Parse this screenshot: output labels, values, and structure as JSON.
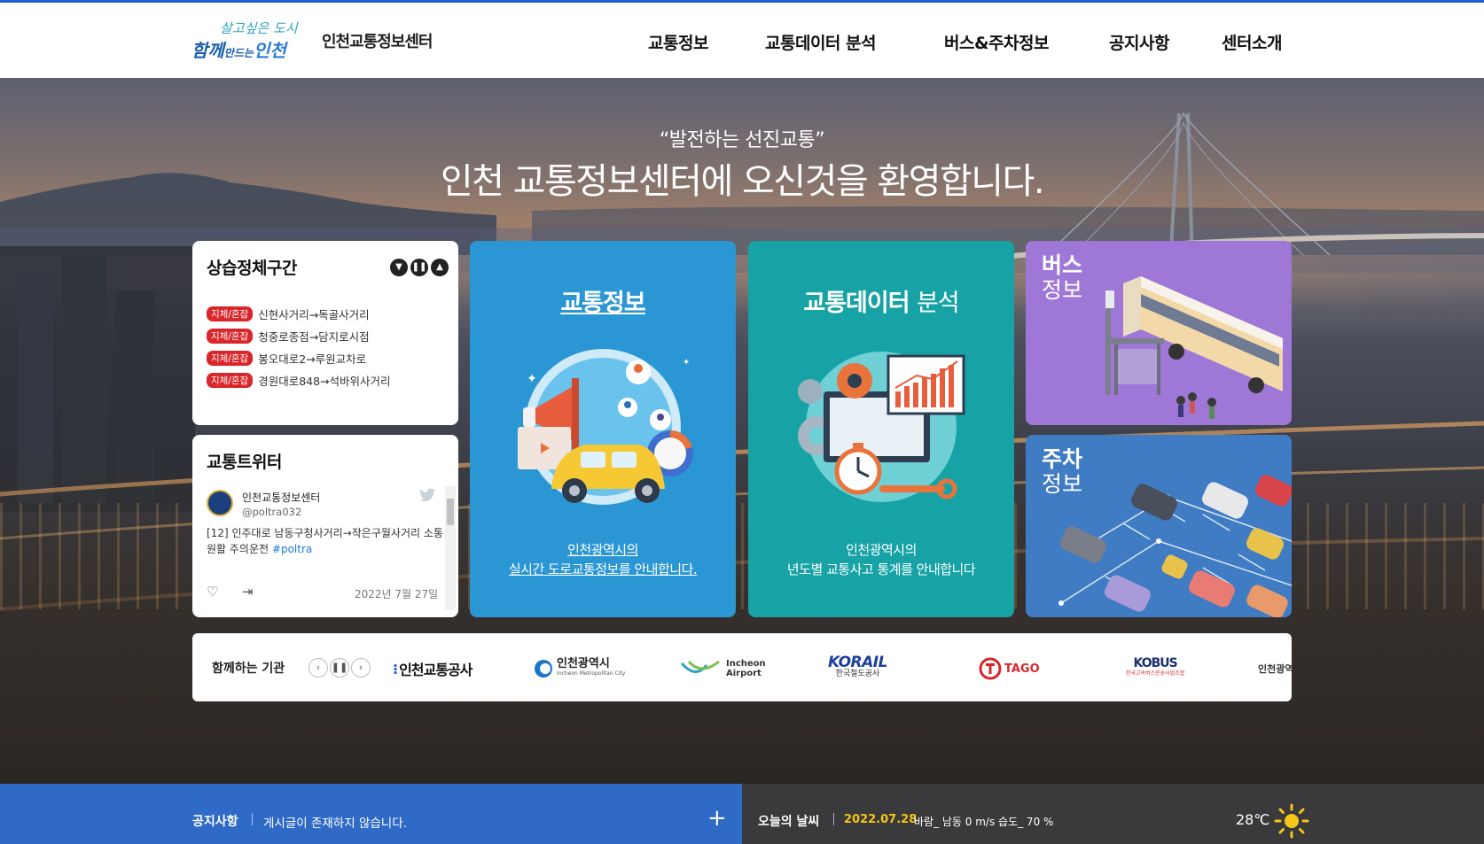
{
  "header": {
    "logo_tagline": "살고싶은 도시",
    "logo_main_1": "함께",
    "logo_main_small": "만드는",
    "logo_main_2": "인천",
    "site_name": "인천교통정보센터",
    "nav": [
      "교통정보",
      "교통데이터 분석",
      "버스&주차정보",
      "공지사항",
      "센터소개"
    ]
  },
  "hero": {
    "subtitle": "“발전하는 선진교통”",
    "title": "인천 교통정보센터에 오신것을 환영합니다."
  },
  "congestion": {
    "title": "상습정체구간",
    "controls": [
      "down",
      "pause",
      "up"
    ],
    "items": [
      {
        "tag": "지체/혼잡",
        "route": "신현사거리→독골사거리"
      },
      {
        "tag": "지체/혼잡",
        "route": "청중로종점→담지로시점"
      },
      {
        "tag": "지체/혼잡",
        "route": "봉오대로2→루원교차로"
      },
      {
        "tag": "지체/혼잡",
        "route": "경원대로848→석바위사거리"
      }
    ]
  },
  "twitter": {
    "title": "교통트위터",
    "name": "인천교통정보센터",
    "handle": "@poltra032",
    "text": "[12] 인주대로 남동구청사거리→작은구월사거리 소통 원활 주의운전",
    "hashtag": "#poltra",
    "date": "2022년 7월 27일"
  },
  "traffic": {
    "title": "교통정보",
    "desc_line1": "인천광역시의",
    "desc_line2": "실시간 도로교통정보를 안내합니다."
  },
  "analysis": {
    "title_bold": "교통데이터",
    "title_thin": "분석",
    "desc_line1": "인천광역시의",
    "desc_line2": "년도별 교통사고 통계를 안내합니다"
  },
  "bus": {
    "title_bold": "버스",
    "title_thin": "정보"
  },
  "parking": {
    "title_bold": "주차",
    "title_thin": "정보"
  },
  "partners": {
    "label": "함께하는 기관",
    "logos": [
      "인천교통공사",
      "인천광역시",
      "Incheon Metropolitan City",
      "Incheon",
      "Airport",
      "KORAIL",
      "한국철도공사",
      "TAGO",
      "KOBUS",
      "한국고속버스운송사업조합",
      "인천광역"
    ]
  },
  "notice": {
    "title": "공지사항",
    "text": "게시글이 존재하지 않습니다."
  },
  "weather": {
    "title": "오늘의 날씨",
    "date": "2022.07.28",
    "info": "바람_ 남동 0 m/s   습도_ 70 %",
    "temp": "28℃"
  },
  "colors": {
    "traffic_card": "#2a97d4",
    "analysis_card": "#17a3a6",
    "bus_card": "#9f77d6",
    "parking_card": "#3f7cc3",
    "congestion_tag": "#d8262b",
    "notice_bar": "#2f6ac6",
    "weather_bar": "#3a3a3c",
    "weather_date": "#f5c518"
  }
}
